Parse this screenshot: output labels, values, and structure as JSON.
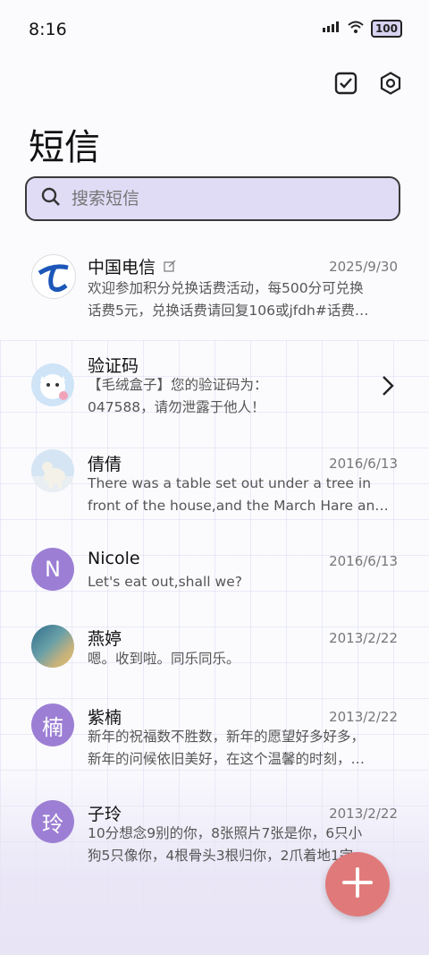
{
  "status": {
    "time": "8:16",
    "battery": "100"
  },
  "header": {
    "title": "短信"
  },
  "search": {
    "placeholder": "搜索短信"
  },
  "conversations": [
    {
      "name": "中国电信",
      "date": "2025/9/30",
      "line1": "欢迎参加积分兑换话费活动，每500分可兑换",
      "line2": "话费5元，兑换话费请回复106或jfdh#话费…"
    },
    {
      "name": "验证码",
      "date": "",
      "line1": "【毛绒盒子】您的验证码为：",
      "line2": "047588，请勿泄露于他人！"
    },
    {
      "name": "倩倩",
      "date": "2016/6/13",
      "line1": "There was a table set out under a tree in",
      "line2": "front of the house,and the March Hare an…"
    },
    {
      "name": "Nicole",
      "date": "2016/6/13",
      "avatar_letter": "N",
      "line1": "Let's eat out,shall we?",
      "line2": ""
    },
    {
      "name": "燕婷",
      "date": "2013/2/22",
      "line1": "嗯。收到啦。同乐同乐。",
      "line2": ""
    },
    {
      "name": "紫楠",
      "date": "2013/2/22",
      "avatar_letter": "楠",
      "line1": "新年的祝福数不胜数，新年的愿望好多好多，",
      "line2": "新年的问候依旧美好，在这个温馨的时刻，…"
    },
    {
      "name": "子玲",
      "date": "2013/2/22",
      "avatar_letter": "玲",
      "line1": "10分想念9别的你，8张照片7张是你，6只小",
      "line2": "狗5只像你，4根骨头3根归你，2爪着地1完…"
    }
  ],
  "colors": {
    "accent": "#9c7fd4",
    "fab": "#e07a7a",
    "search_bg": "#e0dcf6"
  },
  "icons": [
    "select-icon",
    "settings-icon",
    "search-icon",
    "chevron-right-icon",
    "plus-icon"
  ]
}
